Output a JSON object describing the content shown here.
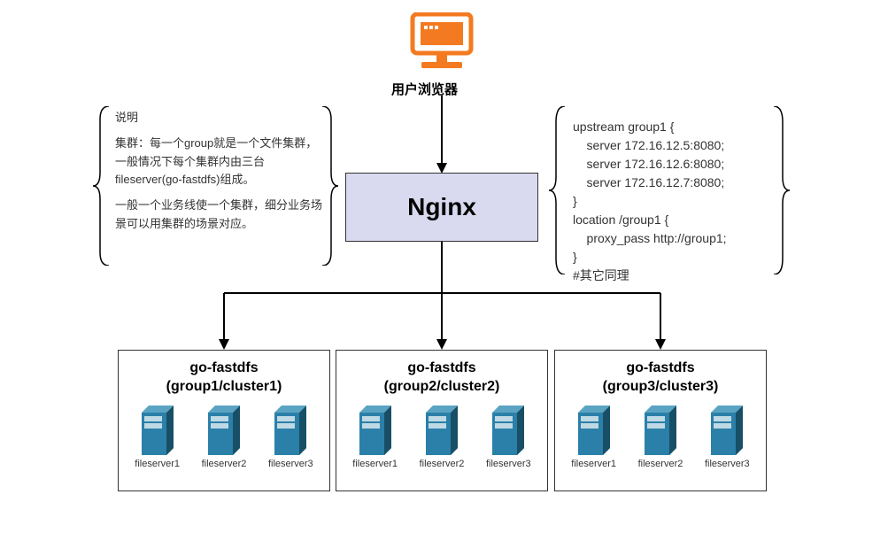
{
  "browser_label": "用户浏览器",
  "nginx_label": "Nginx",
  "left_note": {
    "title": "说明",
    "p1": "集群：每一个group就是一个文件集群，一般情况下每个集群内由三台fileserver(go-fastdfs)组成。",
    "p2": "一般一个业务线使一个集群，细分业务场景可以用集群的场景对应。"
  },
  "right_note": "upstream group1 {\n    server 172.16.12.5:8080;\n    server 172.16.12.6:8080;\n    server 172.16.12.7:8080;\n}\nlocation /group1 {\n    proxy_pass http://group1;\n}\n#其它同理",
  "groups": [
    {
      "title_line1": "go-fastdfs",
      "title_line2": "(group1/cluster1)",
      "servers": [
        "fileserver1",
        "fileserver2",
        "fileserver3"
      ]
    },
    {
      "title_line1": "go-fastdfs",
      "title_line2": "(group2/cluster2)",
      "servers": [
        "fileserver1",
        "fileserver2",
        "fileserver3"
      ]
    },
    {
      "title_line1": "go-fastdfs",
      "title_line2": "(group3/cluster3)",
      "servers": [
        "fileserver1",
        "fileserver2",
        "fileserver3"
      ]
    }
  ],
  "colors": {
    "orange": "#f37a20",
    "nginx_bg": "#d9d9ef",
    "server_blue": "#1f6a8c",
    "server_dark": "#184f67"
  }
}
